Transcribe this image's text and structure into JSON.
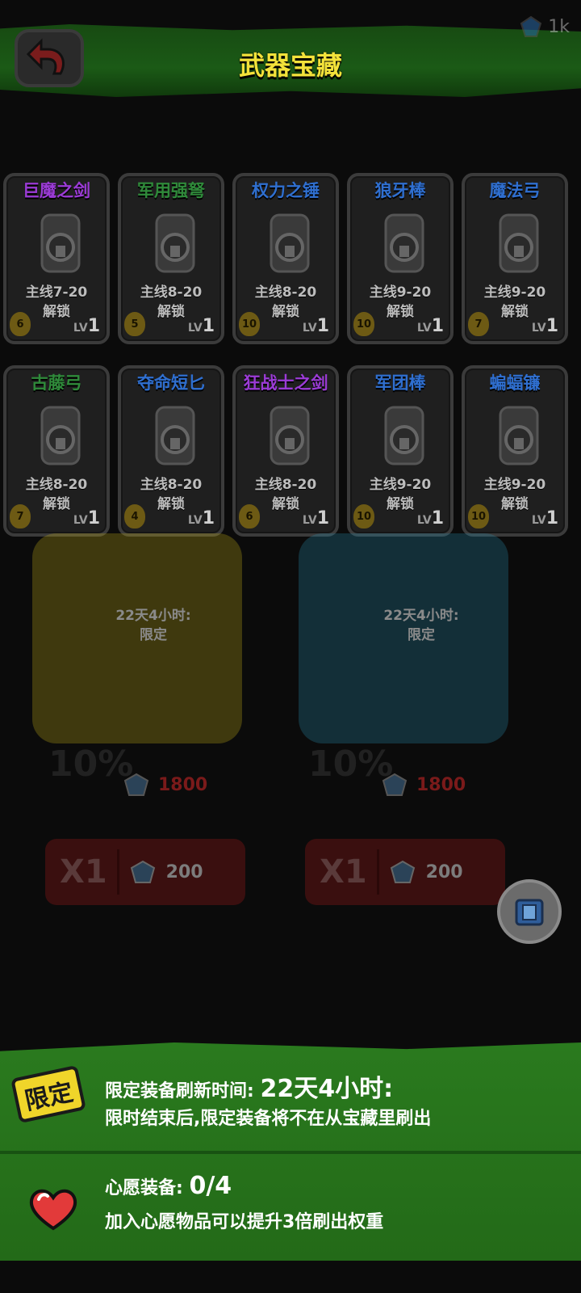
{
  "header": {
    "title": "武器宝藏",
    "currency_amount": "1k"
  },
  "weapons": [
    {
      "name": "巨魔之剑",
      "name_color": "#9b3bd6",
      "condition": "主线7-20",
      "status": "解锁",
      "cost": "6",
      "level_prefix": "LV",
      "level": "1"
    },
    {
      "name": "军用强弩",
      "name_color": "#2f8a3a",
      "condition": "主线8-20",
      "status": "解锁",
      "cost": "5",
      "level_prefix": "LV",
      "level": "1"
    },
    {
      "name": "权力之锤",
      "name_color": "#2f6fd0",
      "condition": "主线8-20",
      "status": "解锁",
      "cost": "10",
      "level_prefix": "LV",
      "level": "1"
    },
    {
      "name": "狼牙棒",
      "name_color": "#2f6fd0",
      "condition": "主线9-20",
      "status": "解锁",
      "cost": "10",
      "level_prefix": "LV",
      "level": "1"
    },
    {
      "name": "魔法弓",
      "name_color": "#2f6fd0",
      "condition": "主线9-20",
      "status": "解锁",
      "cost": "7",
      "level_prefix": "LV",
      "level": "1"
    },
    {
      "name": "古藤弓",
      "name_color": "#2f8a3a",
      "condition": "主线8-20",
      "status": "解锁",
      "cost": "7",
      "level_prefix": "LV",
      "level": "1"
    },
    {
      "name": "夺命短匕",
      "name_color": "#2f6fd0",
      "condition": "主线8-20",
      "status": "解锁",
      "cost": "4",
      "level_prefix": "LV",
      "level": "1"
    },
    {
      "name": "狂战士之剑",
      "name_color": "#9b3bd6",
      "condition": "主线8-20",
      "status": "解锁",
      "cost": "6",
      "level_prefix": "LV",
      "level": "1"
    },
    {
      "name": "军团棒",
      "name_color": "#2f6fd0",
      "condition": "主线9-20",
      "status": "解锁",
      "cost": "10",
      "level_prefix": "LV",
      "level": "1"
    },
    {
      "name": "蝙蝠镰",
      "name_color": "#2f6fd0",
      "condition": "主线9-20",
      "status": "解锁",
      "cost": "10",
      "level_prefix": "LV",
      "level": "1"
    }
  ],
  "chests": [
    {
      "timer": "22天4小时:",
      "limit": "限定",
      "discount": "10%",
      "old_price": "1800",
      "count": "X1",
      "price": "200",
      "color": "#c9b21a"
    },
    {
      "timer": "22天4小时:",
      "limit": "限定",
      "discount": "10%",
      "old_price": "1800",
      "count": "X1",
      "price": "200",
      "color": "#2b8fb0"
    }
  ],
  "info": {
    "limit_tag": "限定",
    "refresh_label": "限定装备刷新时间: ",
    "refresh_time": "22天4小时:",
    "refresh_note": "限时结束后,限定装备将不在从宝藏里刷出",
    "wish_label": "心愿装备: ",
    "wish_count": "0/4",
    "wish_note": "加入心愿物品可以提升3倍刷出权重"
  }
}
